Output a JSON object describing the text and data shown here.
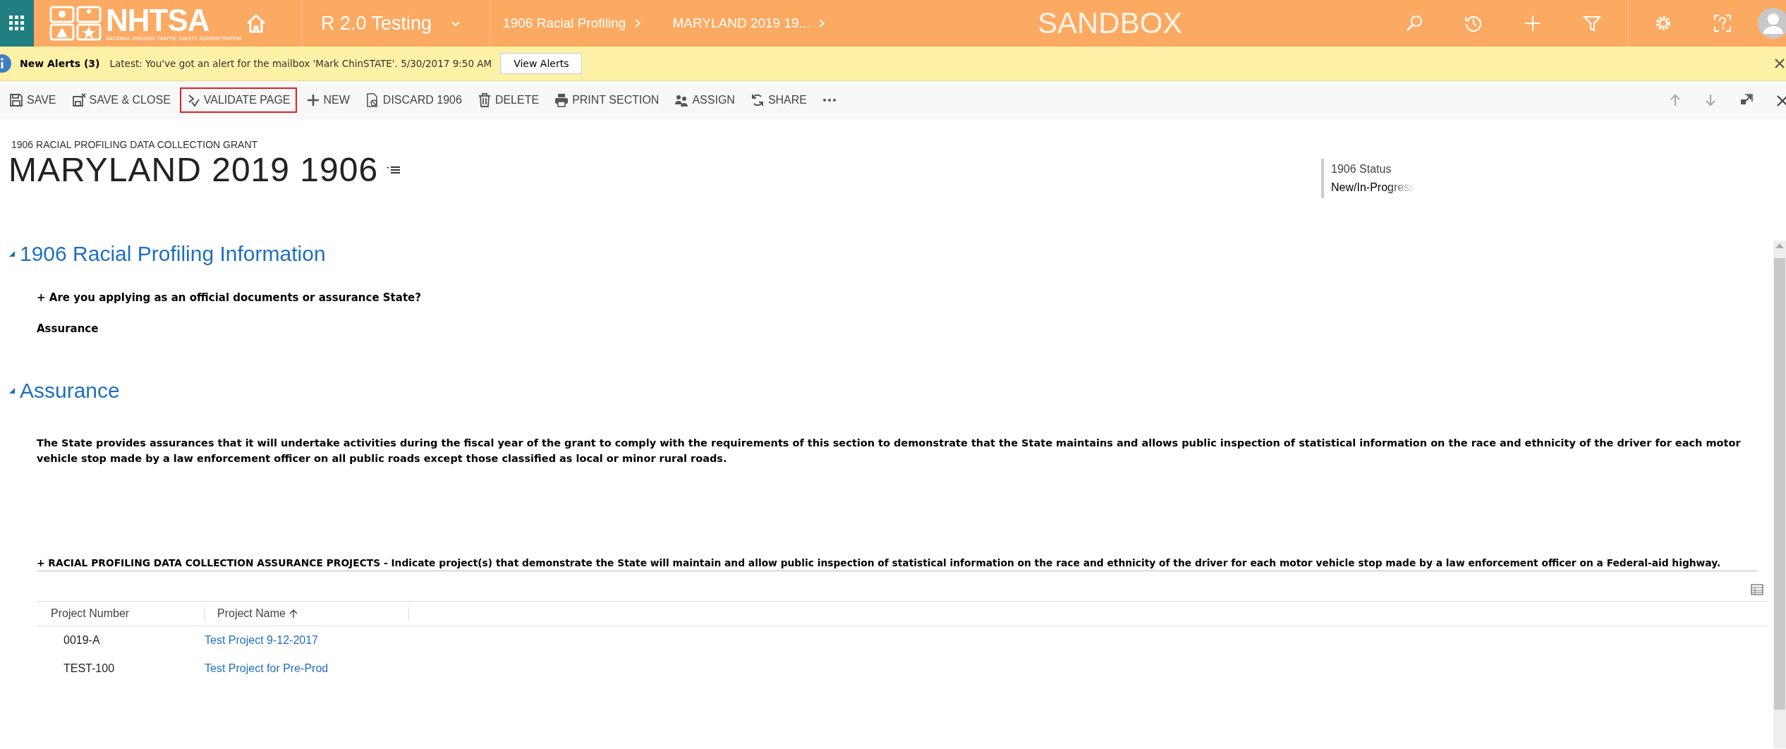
{
  "top_bar": {
    "logo_text": "NHTSA",
    "logo_subtext": "NATIONAL HIGHWAY TRAFFIC SAFETY ADMINISTRATION",
    "app_name": "R 2.0 Testing",
    "breadcrumbs": [
      "1906 Racial Profiling",
      "MARYLAND 2019 19..."
    ],
    "environment": "SANDBOX"
  },
  "alert_bar": {
    "title": "New Alerts (3)",
    "message": "Latest: You've got an alert for the mailbox 'Mark ChinSTATE'. 5/30/2017 9:50 AM",
    "button": "View Alerts"
  },
  "command_bar": [
    {
      "kind": "save",
      "label": "SAVE",
      "highlighted": false
    },
    {
      "kind": "save-close",
      "label": "SAVE & CLOSE",
      "highlighted": false
    },
    {
      "kind": "validate",
      "label": "VALIDATE PAGE",
      "highlighted": true
    },
    {
      "kind": "new",
      "label": "NEW",
      "highlighted": false
    },
    {
      "kind": "discard",
      "label": "DISCARD 1906",
      "highlighted": false
    },
    {
      "kind": "delete",
      "label": "DELETE",
      "highlighted": false
    },
    {
      "kind": "print",
      "label": "PRINT SECTION",
      "highlighted": false
    },
    {
      "kind": "assign",
      "label": "ASSIGN",
      "highlighted": false
    },
    {
      "kind": "share",
      "label": "SHARE",
      "highlighted": false
    },
    {
      "kind": "more",
      "highlighted": false
    }
  ],
  "record": {
    "type": "1906 RACIAL PROFILING DATA COLLECTION GRANT",
    "title": "MARYLAND 2019 1906",
    "status": {
      "label": "1906 Status",
      "value": "New/In-Progress"
    }
  },
  "sections": [
    {
      "title": "1906 Racial Profiling Information",
      "expanded": true,
      "question": "+ Are you applying as an official documents or assurance State?",
      "answer": "Assurance"
    },
    {
      "title": "Assurance",
      "expanded": true,
      "paragraph": "The State provides assurances that it will undertake activities during the fiscal year of the grant to comply with the requirements of this section to demonstrate that the State maintains and allows public inspection of statistical information on the race and ethnicity of the driver for each motor vehicle stop made by a law enforcement officer on all public roads except those classified as local or minor rural roads.",
      "subgrid": {
        "heading": "+ RACIAL PROFILING DATA COLLECTION ASSURANCE PROJECTS - Indicate project(s) that demonstrate the State will maintain and allow public inspection of statistical information on the race and ethnicity of the driver for each motor vehicle stop made by a law enforcement officer on a Federal-aid highway.",
        "columns": [
          {
            "label": "Project Number",
            "sorted": false
          },
          {
            "label": "Project Name",
            "sorted": true
          }
        ],
        "rows": [
          {
            "number": "0019-A",
            "name": "Test Project 9-12-2017"
          },
          {
            "number": "TEST-100",
            "name": "Test Project for Pre-Prod"
          }
        ]
      }
    }
  ]
}
